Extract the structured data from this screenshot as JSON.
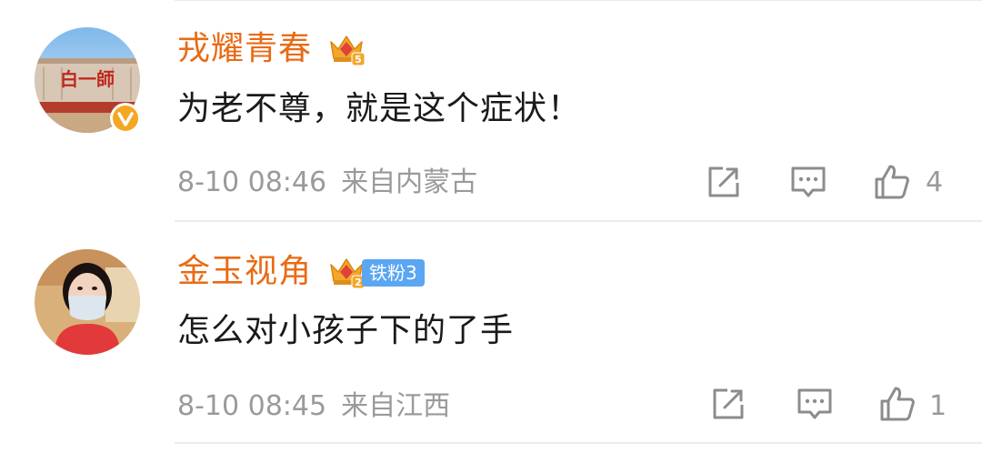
{
  "comments": [
    {
      "username": "戎耀青春",
      "crown_level": "5",
      "verified": true,
      "text": "为老不尊，就是这个症状！",
      "time": "8-10 08:46",
      "location": "来自内蒙古",
      "likes": "4",
      "avatar_icon": "avatar-photo-building-sign",
      "avatar_sign_text": "白一師"
    },
    {
      "username": "金玉视角",
      "crown_level": "2",
      "fan_badge": "铁粉3",
      "text": "怎么对小孩子下的了手",
      "time": "8-10 08:45",
      "location": "来自江西",
      "likes": "1",
      "avatar_icon": "avatar-photo-woman-mask"
    }
  ],
  "colors": {
    "username": "#e86b16",
    "text": "#1a1a1a",
    "meta": "#9a9a9a",
    "fan_badge": "#5aa6f2",
    "verified": "#f5a623"
  }
}
